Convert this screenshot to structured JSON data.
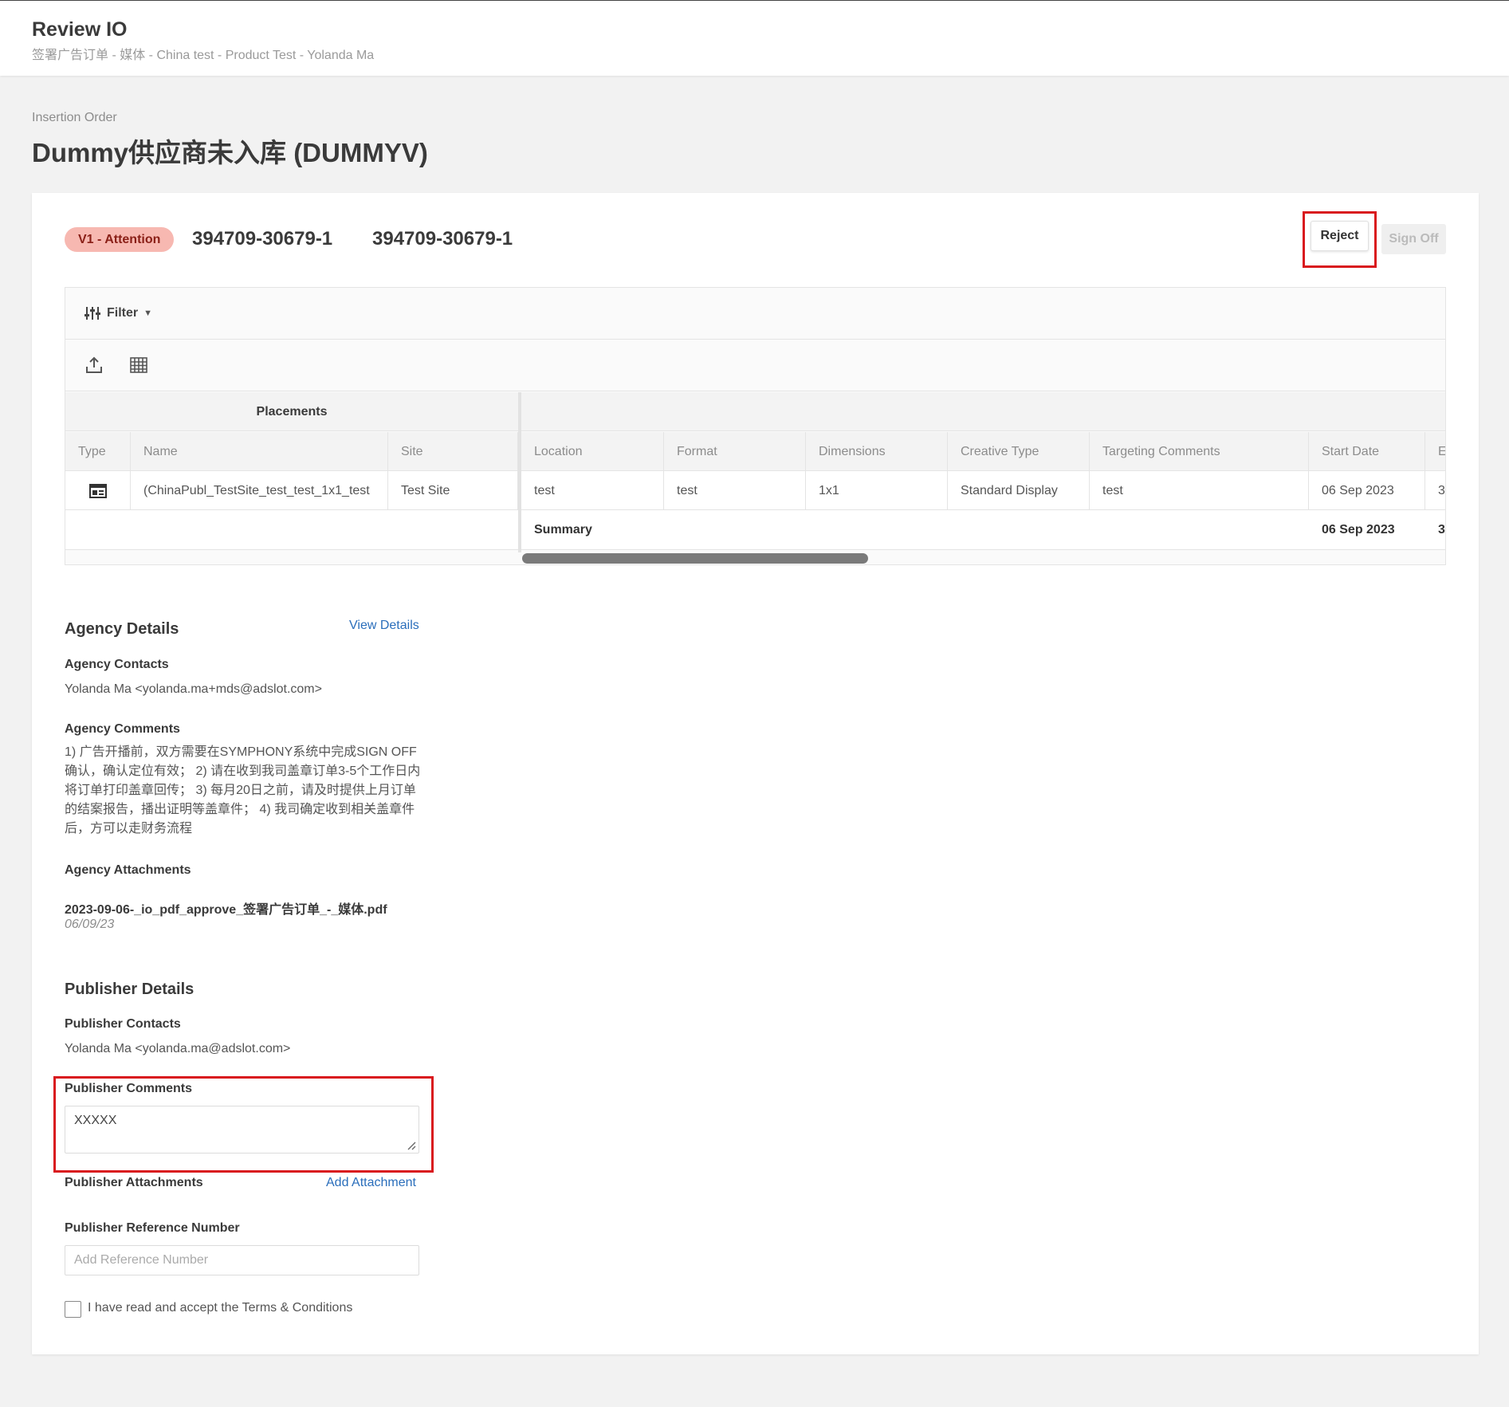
{
  "header": {
    "title": "Review IO",
    "breadcrumb": "签署广告订单 - 媒体 - China test - Product Test - Yolanda Ma"
  },
  "order": {
    "label": "Insertion Order",
    "title": "Dummy供应商未入库 (DUMMYV)",
    "status_badge": "V1 - Attention",
    "io_number_1": "394709-30679-1",
    "io_number_2": "394709-30679-1",
    "reject_label": "Reject",
    "signoff_label": "Sign Off"
  },
  "grid": {
    "filter_label": "Filter",
    "group_header": "Placements",
    "columns": [
      "Type",
      "Name",
      "Site",
      "Location",
      "Format",
      "Dimensions",
      "Creative Type",
      "Targeting Comments",
      "Start Date",
      "E"
    ],
    "row": {
      "name": "(ChinaPubl_TestSite_test_test_1x1_test",
      "site": "Test Site",
      "location": "test",
      "format": "test",
      "dimensions": "1x1",
      "creative_type": "Standard Display",
      "targeting_comments": "test",
      "start_date": "06 Sep 2023",
      "end_partial": "3"
    },
    "summary": {
      "label": "Summary",
      "start_date": "06 Sep 2023",
      "end_partial": "3"
    }
  },
  "agency": {
    "title": "Agency Details",
    "view_details": "View Details",
    "contacts_title": "Agency Contacts",
    "contact": "Yolanda Ma <yolanda.ma+mds@adslot.com>",
    "comments_title": "Agency Comments",
    "comments": "1) 广告开播前，双方需要在SYMPHONY系统中完成SIGN OFF确认，确认定位有效； 2) 请在收到我司盖章订单3-5个工作日内将订单打印盖章回传； 3) 每月20日之前，请及时提供上月订单的结案报告，播出证明等盖章件； 4) 我司确定收到相关盖章件后，方可以走财务流程",
    "attachments_title": "Agency Attachments",
    "attachment_name": "2023-09-06-_io_pdf_approve_签署广告订单_-_媒体.pdf",
    "attachment_date": "06/09/23"
  },
  "publisher": {
    "title": "Publisher Details",
    "contacts_title": "Publisher Contacts",
    "contact": "Yolanda Ma <yolanda.ma@adslot.com>",
    "comments_title": "Publisher Comments",
    "comments_value": "XXXXX",
    "attachments_title": "Publisher Attachments",
    "add_attachment": "Add Attachment",
    "reference_title": "Publisher Reference Number",
    "reference_placeholder": "Add Reference Number",
    "terms_label": "I have read and accept the Terms & Conditions"
  },
  "colors": {
    "badge_bg": "#f7b8b1",
    "highlight": "#d9181e",
    "link": "#2a6ebb"
  }
}
